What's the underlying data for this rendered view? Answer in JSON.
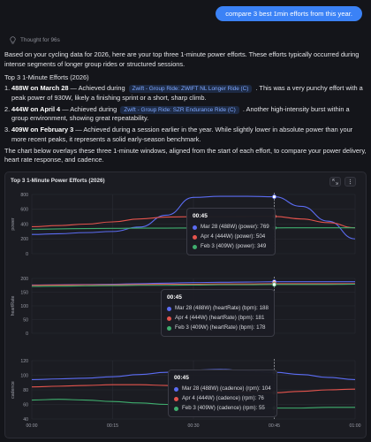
{
  "user_message": "compare 3 best 1min efforts from this year.",
  "thought": "Thought for 96s",
  "intro": "Based on your cycling data for 2026, here are your top three 1-minute power efforts. These efforts typically occurred during intense segments of longer group rides or structured sessions.",
  "section_title": "Top 3 1-Minute Efforts (2026)",
  "efforts": [
    {
      "num": "1.",
      "bold": "488W on March 28",
      "pre": " — Achieved during ",
      "chip": "Zwift - Group Ride: ZWIFT NL Longer Ride (C)",
      "post": " . This was a very punchy effort with a peak power of 930W, likely a finishing sprint or a short, sharp climb."
    },
    {
      "num": "2.",
      "bold": "444W on April 4",
      "pre": " — Achieved during ",
      "chip": "Zwift - Group Ride: SZR Endurance Ride (C)",
      "post": " . Another high-intensity burst within a group environment, showing great repeatability."
    },
    {
      "num": "3.",
      "bold": "409W on February 3",
      "pre": "",
      "chip": "",
      "post": " — Achieved during a session earlier in the year. While slightly lower in absolute power than your more recent peaks, it represents a solid early-season benchmark."
    }
  ],
  "chart_intro": "The chart below overlays these three 1-minute windows, aligned from the start of each effort, to compare your power delivery, heart rate response, and cadence.",
  "chart": {
    "title": "Top 3 1-Minute Power Efforts (2026)",
    "tool_icons": [
      "expand-arrows-icon",
      "more-vertical-icon"
    ],
    "colors": {
      "mar28": "#5b6cf2",
      "apr4": "#e5544d",
      "feb3": "#3fae6e"
    },
    "tooltips": [
      {
        "time": "00:45",
        "rows": [
          "Mar 28 (488W) (power): 769",
          "Apr 4 (444W) (power): 504",
          "Feb 3 (409W) (power): 349"
        ]
      },
      {
        "time": "00:45",
        "rows": [
          "Mar 28 (488W) (heartRate) (bpm): 188",
          "Apr 4 (444W) (heartRate) (bpm): 181",
          "Feb 3 (409W) (heartRate) (bpm): 178"
        ]
      },
      {
        "time": "00:45",
        "rows": [
          "Mar 28 (488W) (cadence) (rpm): 104",
          "Apr 4 (444W) (cadence) (rpm): 76",
          "Feb 3 (409W) (cadence) (rpm): 55"
        ]
      }
    ]
  },
  "chart_data": [
    {
      "type": "line",
      "ylabel": "power",
      "x": [
        "00:00",
        "00:05",
        "00:10",
        "00:15",
        "00:20",
        "00:25",
        "00:30",
        "00:35",
        "00:40",
        "00:45",
        "00:50",
        "00:55",
        "01:00"
      ],
      "xticks": [
        "00:00",
        "00:15",
        "00:30",
        "00:45",
        "01:00"
      ],
      "ylim": [
        0,
        800
      ],
      "yticks": [
        0,
        200,
        400,
        600,
        800
      ],
      "series": [
        {
          "name": "Mar 28 (488W)",
          "values": [
            260,
            270,
            285,
            300,
            360,
            520,
            760,
            775,
            775,
            769,
            640,
            440,
            200
          ]
        },
        {
          "name": "Apr 4 (444W)",
          "values": [
            365,
            380,
            400,
            430,
            470,
            495,
            500,
            500,
            502,
            504,
            470,
            420,
            350
          ]
        },
        {
          "name": "Feb 3 (409W)",
          "values": [
            330,
            335,
            340,
            342,
            345,
            346,
            347,
            348,
            348,
            349,
            350,
            350,
            350
          ]
        }
      ]
    },
    {
      "type": "line",
      "ylabel": "heartRate",
      "x": [
        "00:00",
        "00:05",
        "00:10",
        "00:15",
        "00:20",
        "00:25",
        "00:30",
        "00:35",
        "00:40",
        "00:45",
        "00:50",
        "00:55",
        "01:00"
      ],
      "xticks": [
        "00:00",
        "00:15",
        "00:30",
        "00:45",
        "01:00"
      ],
      "ylim": [
        0,
        200
      ],
      "yticks": [
        0,
        50,
        100,
        150,
        200
      ],
      "series": [
        {
          "name": "Mar 28 (488W)",
          "values": [
            176,
            177,
            178,
            179,
            181,
            183,
            185,
            186,
            187,
            188,
            188,
            188,
            188
          ]
        },
        {
          "name": "Apr 4 (444W)",
          "values": [
            175,
            176,
            177,
            177,
            178,
            179,
            179,
            180,
            180,
            181,
            181,
            181,
            181
          ]
        },
        {
          "name": "Feb 3 (409W)",
          "values": [
            171,
            172,
            173,
            174,
            175,
            175,
            176,
            177,
            177,
            178,
            178,
            178,
            179
          ]
        }
      ]
    },
    {
      "type": "line",
      "ylabel": "cadence",
      "x": [
        "00:00",
        "00:05",
        "00:10",
        "00:15",
        "00:20",
        "00:25",
        "00:30",
        "00:35",
        "00:40",
        "00:45",
        "00:50",
        "00:55",
        "01:00"
      ],
      "xticks": [
        "00:00",
        "00:15",
        "00:30",
        "00:45",
        "01:00"
      ],
      "ylim": [
        40,
        120
      ],
      "yticks": [
        40,
        60,
        80,
        100,
        120
      ],
      "series": [
        {
          "name": "Mar 28 (488W)",
          "values": [
            94,
            95,
            96,
            98,
            101,
            104,
            107,
            108,
            106,
            104,
            101,
            97,
            94
          ]
        },
        {
          "name": "Apr 4 (444W)",
          "values": [
            84,
            85,
            86,
            87,
            87,
            86,
            82,
            79,
            77,
            76,
            78,
            80,
            81
          ]
        },
        {
          "name": "Feb 3 (409W)",
          "values": [
            66,
            67,
            66,
            64,
            62,
            60,
            58,
            56,
            55,
            55,
            55,
            56,
            56
          ]
        }
      ]
    }
  ]
}
